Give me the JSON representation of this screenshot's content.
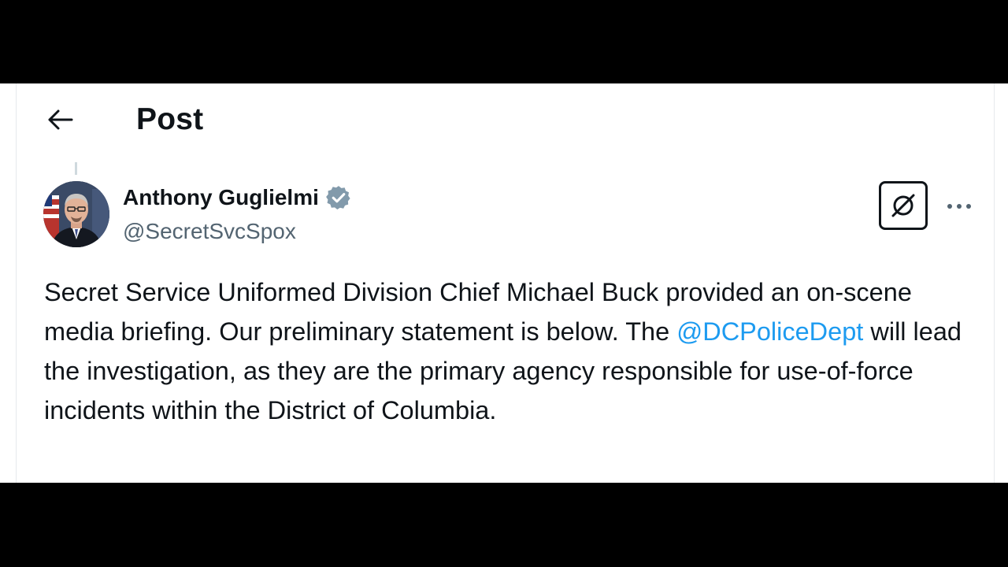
{
  "header": {
    "title": "Post",
    "back_icon": "arrow-left-icon"
  },
  "author": {
    "name": "Anthony Guglielmi",
    "handle": "@SecretSvcSpox",
    "verified_icon": "verified-badge-icon",
    "verified_color": "#829aab"
  },
  "actions": {
    "grok_icon": "grok-icon",
    "more_icon": "more-options-icon"
  },
  "post": {
    "text_before_mention": "Secret Service Uniformed Division Chief Michael Buck provided an on-scene media briefing. Our preliminary statement is below. The ",
    "mention": "@DCPoliceDept",
    "text_after_mention": " will lead the investigation, as they are the primary agency responsible for use-of-force incidents within the District of Columbia."
  },
  "colors": {
    "text_primary": "#0f1419",
    "text_secondary": "#536471",
    "link": "#1d9bf0",
    "background": "#ffffff"
  }
}
